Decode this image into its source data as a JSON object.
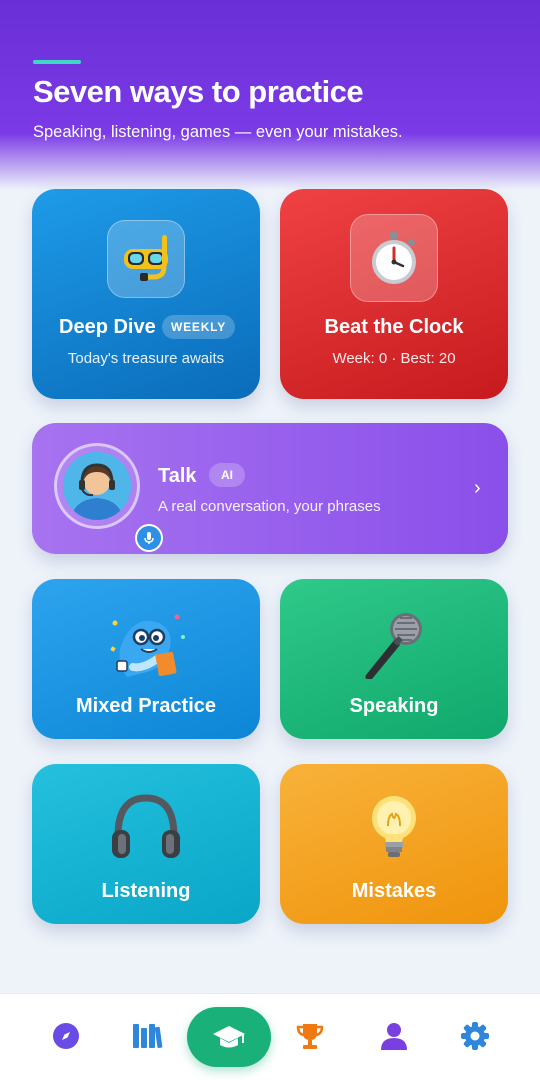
{
  "header": {
    "title": "Seven ways to practice",
    "subtitle": "Speaking, listening, games — even your mistakes."
  },
  "cards": {
    "deep_dive": {
      "title": "Deep Dive",
      "badge": "WEEKLY",
      "subtitle": "Today's treasure awaits",
      "icon": "snorkel-mask-icon",
      "color": "#0a6cba"
    },
    "beat_clock": {
      "title": "Beat the Clock",
      "subtitle": "Week: 0 · Best: 20",
      "icon": "stopwatch-icon",
      "color": "#d92a2c"
    },
    "talk": {
      "title": "Talk",
      "badge": "AI",
      "subtitle": "A real conversation, your phrases",
      "icon": "support-agent-avatar",
      "color": "#9a62ee"
    },
    "mixed": {
      "title": "Mixed Practice",
      "icon": "dolphin-mascot-icon",
      "color": "#1a95e2"
    },
    "speaking": {
      "title": "Speaking",
      "icon": "microphone-icon",
      "color": "#1fb97b"
    },
    "listening": {
      "title": "Listening",
      "icon": "headphones-icon",
      "color": "#18b3d3"
    },
    "mistakes": {
      "title": "Mistakes",
      "icon": "light-bulb-icon",
      "color": "#f4a222"
    }
  },
  "nav": {
    "items": [
      "compass-icon",
      "library-icon",
      "graduation-cap-icon",
      "trophy-icon",
      "profile-icon",
      "gear-icon"
    ],
    "active": "graduation-cap-icon"
  }
}
